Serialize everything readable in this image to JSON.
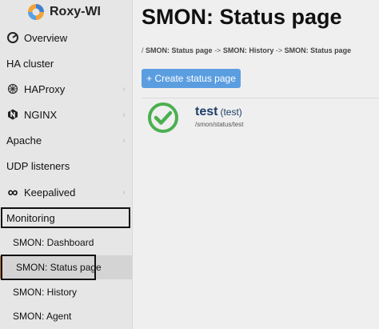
{
  "app": {
    "name": "Roxy-WI"
  },
  "sidebar": {
    "items": [
      {
        "label": "Overview",
        "icon": "dashboard-icon"
      },
      {
        "label": "HA cluster"
      },
      {
        "label": "HAProxy",
        "icon": "haproxy-icon"
      },
      {
        "label": "NGINX",
        "icon": "nginx-icon"
      },
      {
        "label": "Apache"
      },
      {
        "label": "UDP listeners"
      },
      {
        "label": "Keepalived",
        "icon": "infinity-icon"
      },
      {
        "label": "Monitoring"
      }
    ],
    "sub_items": [
      {
        "label": "SMON: Dashboard"
      },
      {
        "label": "SMON: Status page"
      },
      {
        "label": "SMON: History"
      },
      {
        "label": "SMON: Agent"
      }
    ]
  },
  "main": {
    "title": "SMON: Status page",
    "breadcrumb": {
      "root": "/",
      "items": [
        "SMON: Status page",
        "SMON: History",
        "SMON: Status page"
      ],
      "separator": "->"
    },
    "create_button": "+ Create status page",
    "status_pages": [
      {
        "name": "test",
        "desc": "(test)",
        "path": "/smon/status/test",
        "status": "ok"
      }
    ]
  },
  "colors": {
    "accent": "#5b9ee0",
    "ok": "#4caf50",
    "title": "#1e3e67"
  }
}
